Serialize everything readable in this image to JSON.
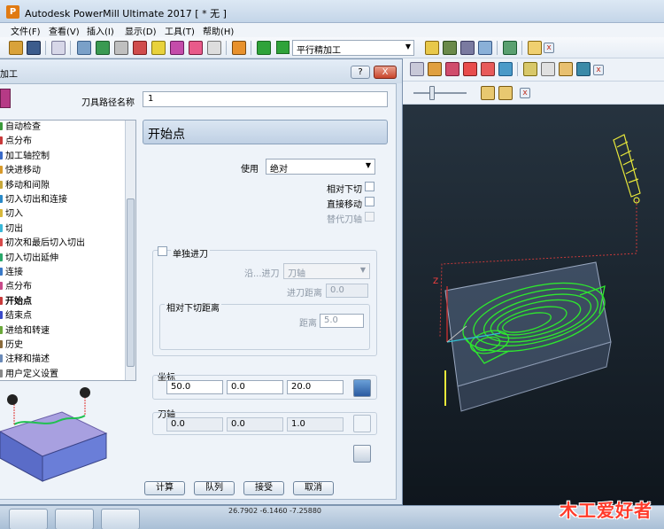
{
  "app": {
    "icon_letter": "P",
    "title": "Autodesk PowerMill Ultimate 2017    [ * 无 ]"
  },
  "menu": [
    {
      "label": "文件(F)"
    },
    {
      "label": "查看(V)"
    },
    {
      "label": "插入(I)"
    },
    {
      "label": "显示(D)"
    },
    {
      "label": "工具(T)"
    },
    {
      "label": "帮助(H)"
    }
  ],
  "toolbar": {
    "strategy_label": "平行精加工",
    "close_glyph": "x"
  },
  "dialog": {
    "title": "加工",
    "help_label": "?",
    "close_glyph": "X",
    "toolpath_name_label": "刀具路径名称",
    "toolpath_name": "1",
    "page_title": "开始点",
    "use_label": "使用",
    "use_value": "绝对",
    "relative_plunge_label": "相对下切",
    "direct_move_label": "直接移动",
    "alt_axis_label": "替代刀轴",
    "separate_approach_label": "单独进刀",
    "along_label": "沿...进刀",
    "along_value": "刀轴",
    "approach_dist_label": "进刀距离",
    "approach_dist_value": "0.0",
    "relative_plunge_dist_label": "相对下切距离",
    "distance_label": "距离",
    "distance_value": "5.0",
    "coords_label": "坐标",
    "coords": [
      "50.0",
      "0.0",
      "20.0"
    ],
    "tool_axis_label": "刀轴",
    "tool_axis": [
      "0.0",
      "0.0",
      "1.0"
    ],
    "buttons": {
      "calculate": "计算",
      "queue": "队列",
      "accept": "接受",
      "cancel": "取消"
    }
  },
  "tree": [
    {
      "label": "自动检查",
      "icon": "check-icon",
      "selected": false
    },
    {
      "label": "点分布",
      "icon": "points-icon",
      "selected": false
    },
    {
      "label": "加工轴控制",
      "icon": "axis-icon",
      "selected": false
    },
    {
      "label": "快进移动",
      "icon": "rapid-icon",
      "selected": false
    },
    {
      "label": "移动和间隙",
      "icon": "moves-icon",
      "selected": false
    },
    {
      "label": "切入切出和连接",
      "icon": "leads-icon",
      "selected": false
    },
    {
      "label": "切入",
      "icon": "lead-in-icon",
      "selected": false
    },
    {
      "label": "切出",
      "icon": "lead-out-icon",
      "selected": false
    },
    {
      "label": "初次和最后切入切出",
      "icon": "first-last-icon",
      "selected": false
    },
    {
      "label": "切入切出延伸",
      "icon": "extension-icon",
      "selected": false
    },
    {
      "label": "连接",
      "icon": "links-icon",
      "selected": false
    },
    {
      "label": "点分布",
      "icon": "points-icon",
      "selected": false
    },
    {
      "label": "开始点",
      "icon": "start-point-icon",
      "selected": true
    },
    {
      "label": "结束点",
      "icon": "end-point-icon",
      "selected": false
    },
    {
      "label": "进给和转速",
      "icon": "feeds-icon",
      "selected": false
    },
    {
      "label": "历史",
      "icon": "history-icon",
      "selected": false
    },
    {
      "label": "注释和描述",
      "icon": "notes-icon",
      "selected": false
    },
    {
      "label": "用户定义设置",
      "icon": "user-settings-icon",
      "selected": false
    }
  ],
  "taskbar": {
    "coords_readout": "26.7902    -6.1460    -7.25880",
    "watermark_text": "木工爱好者"
  },
  "colors": {
    "viewport_top": "#26333f",
    "toolpath": "#2ee82e",
    "tool": "#e8e83a",
    "stock": "#5a6d8a"
  }
}
